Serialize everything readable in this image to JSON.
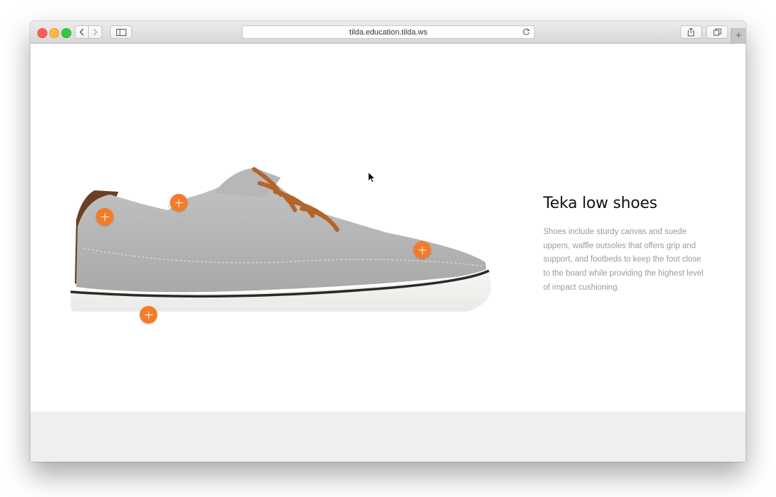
{
  "browser": {
    "url": "tilda.education.tilda.ws",
    "newtab_label": "+"
  },
  "product": {
    "title": "Teka low shoes",
    "description": "Shoes include sturdy canvas and suede uppers, waffle outsoles that offers grip and support, and footbeds to keep the foot close to the board while providing the highest level of impact cushioning."
  },
  "hotspots": [
    {
      "label": "+",
      "name": "heel-tab"
    },
    {
      "label": "+",
      "name": "collar"
    },
    {
      "label": "+",
      "name": "toe-upper"
    },
    {
      "label": "+",
      "name": "sole"
    }
  ],
  "colors": {
    "accent": "#f47b2a",
    "footer": "#efefef"
  }
}
